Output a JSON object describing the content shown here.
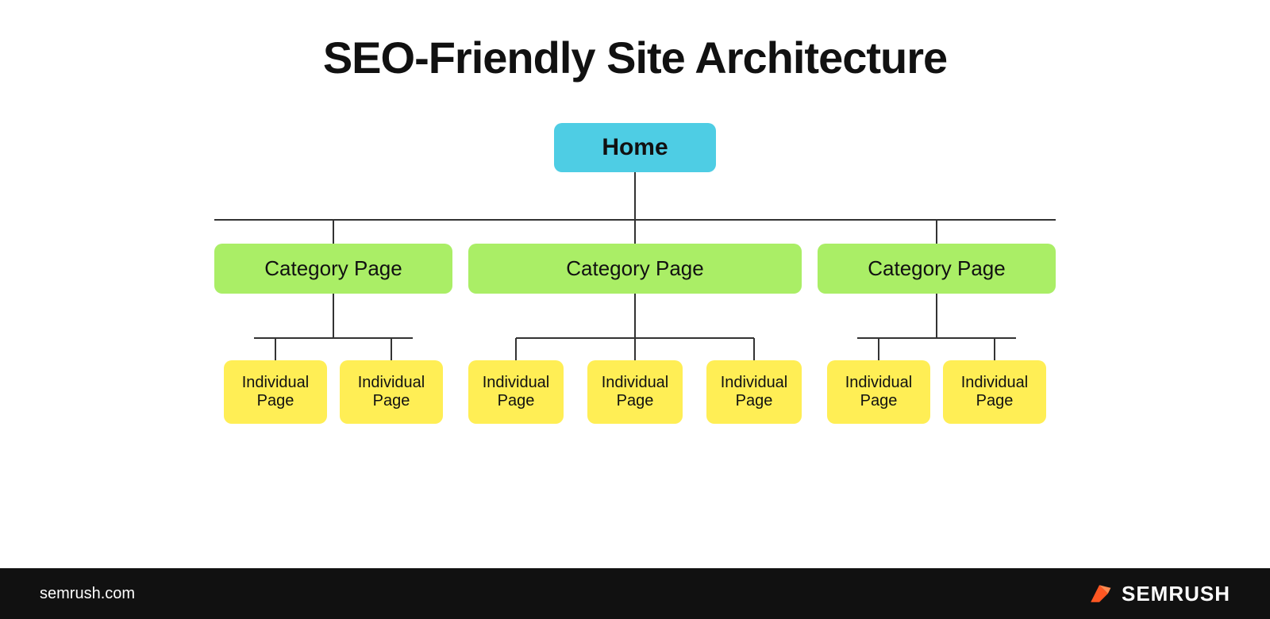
{
  "title": "SEO-Friendly Site Architecture",
  "home": "Home",
  "categories": [
    {
      "label": "Category Page"
    },
    {
      "label": "Category Page"
    },
    {
      "label": "Category Page"
    }
  ],
  "individual_pages": {
    "left": [
      "Individual Page",
      "Individual Page"
    ],
    "middle": [
      "Individual Page",
      "Individual Page",
      "Individual Page"
    ],
    "right": [
      "Individual Page",
      "Individual Page"
    ]
  },
  "footer": {
    "url": "semrush.com",
    "brand": "SEMRUSH"
  },
  "colors": {
    "home_bg": "#4ecde4",
    "category_bg": "#aaee66",
    "individual_bg": "#ffee55",
    "footer_bg": "#111111",
    "semrush_orange": "#ff5722"
  }
}
